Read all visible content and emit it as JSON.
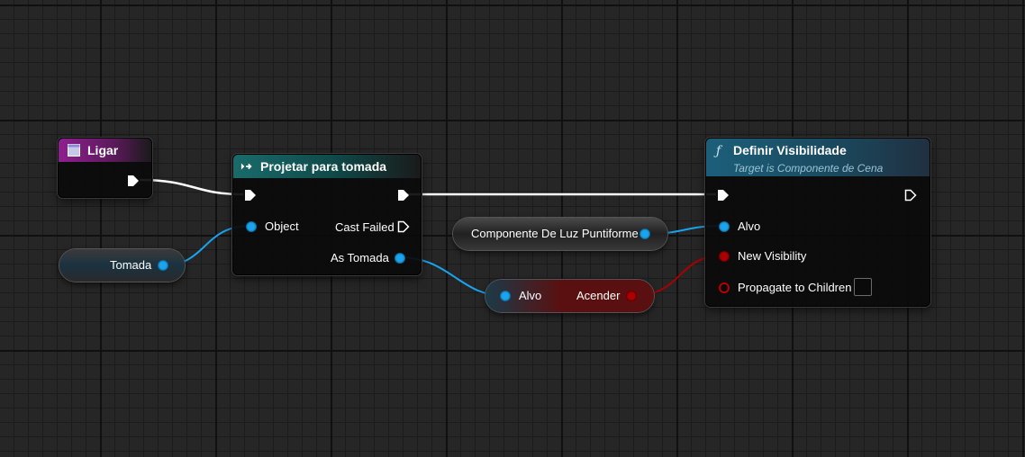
{
  "nodes": {
    "ligar": {
      "title": "Ligar"
    },
    "projetar": {
      "title": "Projetar para tomada",
      "object_label": "Object",
      "cast_failed_label": "Cast Failed",
      "as_tomada_label": "As Tomada"
    },
    "definir": {
      "title": "Definir Visibilidade",
      "subtitle": "Target is Componente de Cena",
      "alvo_label": "Alvo",
      "new_visibility_label": "New Visibility",
      "propagate_label": "Propagate to Children"
    },
    "tomada_var": {
      "label": "Tomada"
    },
    "componente_var": {
      "label": "Componente De Luz Puntiforme"
    },
    "alvo_acender": {
      "alvo_label": "Alvo",
      "acender_label": "Acender"
    }
  },
  "colors": {
    "object_pin": "#1aa3ef",
    "bool_pin": "#a00000",
    "exec_wire": "#ffffff",
    "event_header": "#8f1f8f",
    "cast_header": "#1a6b6b",
    "func_header": "#1c5f7a"
  },
  "icons": [
    "event-icon",
    "cast-icon",
    "function-icon",
    "exec-pin-icon"
  ]
}
